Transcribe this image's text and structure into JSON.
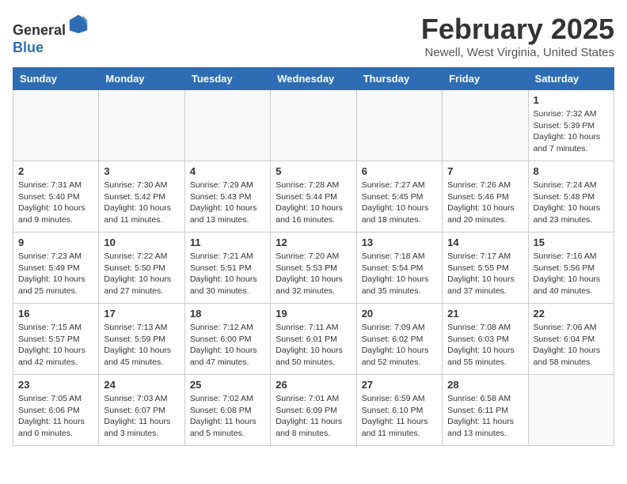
{
  "header": {
    "logo_line1": "General",
    "logo_line2": "Blue",
    "month": "February 2025",
    "location": "Newell, West Virginia, United States"
  },
  "weekdays": [
    "Sunday",
    "Monday",
    "Tuesday",
    "Wednesday",
    "Thursday",
    "Friday",
    "Saturday"
  ],
  "weeks": [
    [
      {
        "day": "",
        "info": ""
      },
      {
        "day": "",
        "info": ""
      },
      {
        "day": "",
        "info": ""
      },
      {
        "day": "",
        "info": ""
      },
      {
        "day": "",
        "info": ""
      },
      {
        "day": "",
        "info": ""
      },
      {
        "day": "1",
        "info": "Sunrise: 7:32 AM\nSunset: 5:39 PM\nDaylight: 10 hours\nand 7 minutes."
      }
    ],
    [
      {
        "day": "2",
        "info": "Sunrise: 7:31 AM\nSunset: 5:40 PM\nDaylight: 10 hours\nand 9 minutes."
      },
      {
        "day": "3",
        "info": "Sunrise: 7:30 AM\nSunset: 5:42 PM\nDaylight: 10 hours\nand 11 minutes."
      },
      {
        "day": "4",
        "info": "Sunrise: 7:29 AM\nSunset: 5:43 PM\nDaylight: 10 hours\nand 13 minutes."
      },
      {
        "day": "5",
        "info": "Sunrise: 7:28 AM\nSunset: 5:44 PM\nDaylight: 10 hours\nand 16 minutes."
      },
      {
        "day": "6",
        "info": "Sunrise: 7:27 AM\nSunset: 5:45 PM\nDaylight: 10 hours\nand 18 minutes."
      },
      {
        "day": "7",
        "info": "Sunrise: 7:26 AM\nSunset: 5:46 PM\nDaylight: 10 hours\nand 20 minutes."
      },
      {
        "day": "8",
        "info": "Sunrise: 7:24 AM\nSunset: 5:48 PM\nDaylight: 10 hours\nand 23 minutes."
      }
    ],
    [
      {
        "day": "9",
        "info": "Sunrise: 7:23 AM\nSunset: 5:49 PM\nDaylight: 10 hours\nand 25 minutes."
      },
      {
        "day": "10",
        "info": "Sunrise: 7:22 AM\nSunset: 5:50 PM\nDaylight: 10 hours\nand 27 minutes."
      },
      {
        "day": "11",
        "info": "Sunrise: 7:21 AM\nSunset: 5:51 PM\nDaylight: 10 hours\nand 30 minutes."
      },
      {
        "day": "12",
        "info": "Sunrise: 7:20 AM\nSunset: 5:53 PM\nDaylight: 10 hours\nand 32 minutes."
      },
      {
        "day": "13",
        "info": "Sunrise: 7:18 AM\nSunset: 5:54 PM\nDaylight: 10 hours\nand 35 minutes."
      },
      {
        "day": "14",
        "info": "Sunrise: 7:17 AM\nSunset: 5:55 PM\nDaylight: 10 hours\nand 37 minutes."
      },
      {
        "day": "15",
        "info": "Sunrise: 7:16 AM\nSunset: 5:56 PM\nDaylight: 10 hours\nand 40 minutes."
      }
    ],
    [
      {
        "day": "16",
        "info": "Sunrise: 7:15 AM\nSunset: 5:57 PM\nDaylight: 10 hours\nand 42 minutes."
      },
      {
        "day": "17",
        "info": "Sunrise: 7:13 AM\nSunset: 5:59 PM\nDaylight: 10 hours\nand 45 minutes."
      },
      {
        "day": "18",
        "info": "Sunrise: 7:12 AM\nSunset: 6:00 PM\nDaylight: 10 hours\nand 47 minutes."
      },
      {
        "day": "19",
        "info": "Sunrise: 7:11 AM\nSunset: 6:01 PM\nDaylight: 10 hours\nand 50 minutes."
      },
      {
        "day": "20",
        "info": "Sunrise: 7:09 AM\nSunset: 6:02 PM\nDaylight: 10 hours\nand 52 minutes."
      },
      {
        "day": "21",
        "info": "Sunrise: 7:08 AM\nSunset: 6:03 PM\nDaylight: 10 hours\nand 55 minutes."
      },
      {
        "day": "22",
        "info": "Sunrise: 7:06 AM\nSunset: 6:04 PM\nDaylight: 10 hours\nand 58 minutes."
      }
    ],
    [
      {
        "day": "23",
        "info": "Sunrise: 7:05 AM\nSunset: 6:06 PM\nDaylight: 11 hours\nand 0 minutes."
      },
      {
        "day": "24",
        "info": "Sunrise: 7:03 AM\nSunset: 6:07 PM\nDaylight: 11 hours\nand 3 minutes."
      },
      {
        "day": "25",
        "info": "Sunrise: 7:02 AM\nSunset: 6:08 PM\nDaylight: 11 hours\nand 5 minutes."
      },
      {
        "day": "26",
        "info": "Sunrise: 7:01 AM\nSunset: 6:09 PM\nDaylight: 11 hours\nand 8 minutes."
      },
      {
        "day": "27",
        "info": "Sunrise: 6:59 AM\nSunset: 6:10 PM\nDaylight: 11 hours\nand 11 minutes."
      },
      {
        "day": "28",
        "info": "Sunrise: 6:58 AM\nSunset: 6:11 PM\nDaylight: 11 hours\nand 13 minutes."
      },
      {
        "day": "",
        "info": ""
      }
    ]
  ]
}
